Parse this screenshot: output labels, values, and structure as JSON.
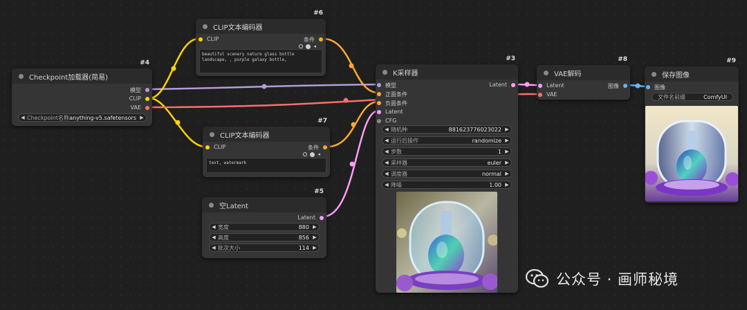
{
  "nodes": {
    "checkpoint": {
      "id": "#4",
      "title": "Checkpoint加载器(简易)",
      "outputs": [
        "模型",
        "CLIP",
        "VAE"
      ],
      "widget_label": "Checkpoint名称",
      "widget_value": "anything-v5.safetensors"
    },
    "clip6": {
      "id": "#6",
      "title": "CLIP文本编码器",
      "input": "CLIP",
      "output": "条件",
      "text": "beautiful scenery nature glass bottle landscape, , purple galaxy bottle,"
    },
    "clip7": {
      "id": "#7",
      "title": "CLIP文本编码器",
      "input": "CLIP",
      "output": "条件",
      "text": "text, watermark"
    },
    "latent5": {
      "id": "#5",
      "title": "空Latent",
      "output": "Latent",
      "widgets": [
        {
          "label": "宽度",
          "value": "880"
        },
        {
          "label": "高度",
          "value": "856"
        },
        {
          "label": "批次大小",
          "value": "114"
        }
      ]
    },
    "ksampler": {
      "id": "#3",
      "title": "K采样器",
      "inputs": [
        "模型",
        "正面条件",
        "负面条件",
        "Latent",
        "CFG"
      ],
      "output": "Latent",
      "widgets": [
        {
          "label": "随机种",
          "value": "881623776023022"
        },
        {
          "label": "运行后操作",
          "value": "randomize"
        },
        {
          "label": "步数",
          "value": "1"
        },
        {
          "label": "采样器",
          "value": "euler"
        },
        {
          "label": "调度器",
          "value": "normal"
        },
        {
          "label": "降噪",
          "value": "1.00"
        }
      ]
    },
    "vae": {
      "id": "#8",
      "title": "VAE解码",
      "inputs": [
        "Latent",
        "VAE"
      ],
      "output": "图像"
    },
    "save": {
      "id": "#9",
      "title": "保存图像",
      "input": "图像",
      "widget_label": "文件名前缀",
      "widget_value": "ComfyUI"
    }
  },
  "watermark": {
    "text": "公众号 · 画师秘境"
  },
  "colors": {
    "model": "#b39ddb",
    "clip": "#ffd500",
    "vae": "#ff6e6e",
    "conditioning": "#ffa931",
    "latent": "#ff9cf9",
    "image": "#64b5f6",
    "canvas": "#1f1f1f",
    "node": "#353535"
  }
}
